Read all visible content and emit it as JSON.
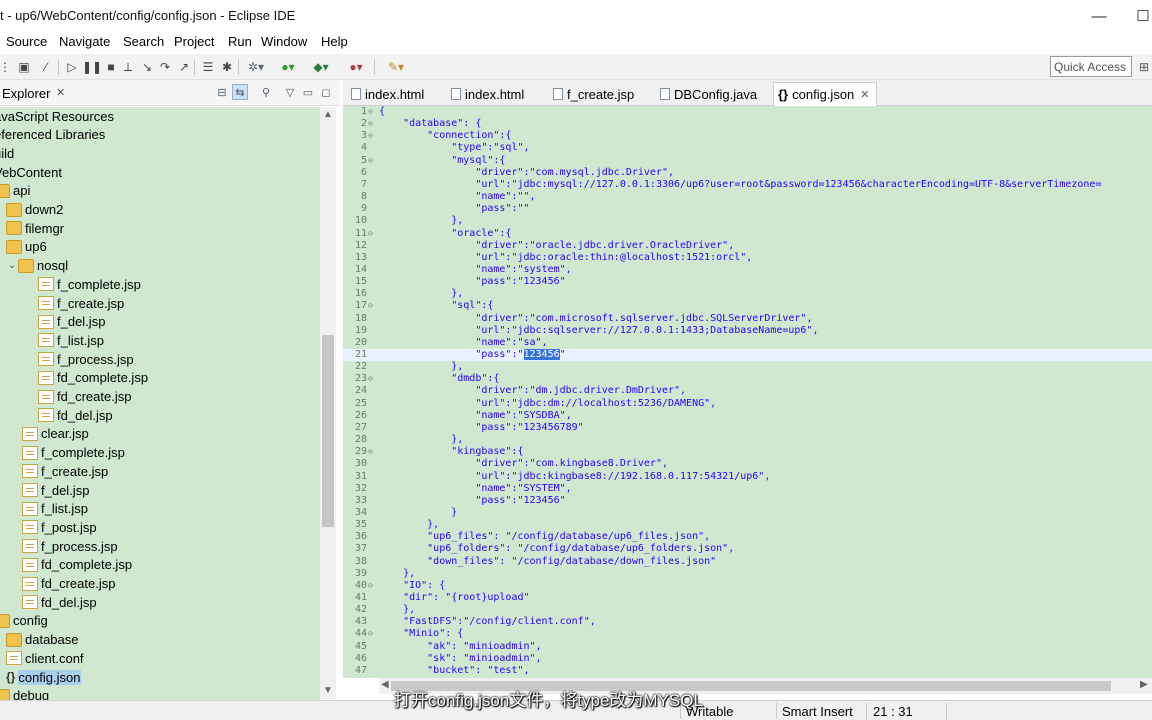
{
  "window": {
    "title": "t - up6/WebContent/config/config.json - Eclipse IDE",
    "minimize": "—",
    "maximize": "☐"
  },
  "menu": [
    "Source",
    "Navigate",
    "Search",
    "Project",
    "Run",
    "Window",
    "Help"
  ],
  "toolbar": {
    "quick_access": "Quick Access"
  },
  "explorer": {
    "title": "Explorer",
    "close": "✕",
    "tree": [
      {
        "label": "avaScript Resources",
        "kind": "plain",
        "indent": 0
      },
      {
        "label": "eferenced Libraries",
        "kind": "plain",
        "indent": 0
      },
      {
        "label": "uild",
        "kind": "plain",
        "indent": 0
      },
      {
        "label": "VebContent",
        "kind": "plain",
        "indent": 0
      },
      {
        "label": "api",
        "kind": "folder",
        "indent": 0
      },
      {
        "label": "down2",
        "kind": "folder",
        "indent": 1
      },
      {
        "label": "filemgr",
        "kind": "folder",
        "indent": 1
      },
      {
        "label": "up6",
        "kind": "folder",
        "indent": 1
      },
      {
        "label": "nosql",
        "kind": "folder-open",
        "indent": 1
      },
      {
        "label": "f_complete.jsp",
        "kind": "file",
        "indent": 3
      },
      {
        "label": "f_create.jsp",
        "kind": "file",
        "indent": 3
      },
      {
        "label": "f_del.jsp",
        "kind": "file",
        "indent": 3
      },
      {
        "label": "f_list.jsp",
        "kind": "file",
        "indent": 3
      },
      {
        "label": "f_process.jsp",
        "kind": "file",
        "indent": 3
      },
      {
        "label": "fd_complete.jsp",
        "kind": "file",
        "indent": 3
      },
      {
        "label": "fd_create.jsp",
        "kind": "file",
        "indent": 3
      },
      {
        "label": "fd_del.jsp",
        "kind": "file",
        "indent": 3
      },
      {
        "label": "clear.jsp",
        "kind": "file",
        "indent": 2
      },
      {
        "label": "f_complete.jsp",
        "kind": "file",
        "indent": 2
      },
      {
        "label": "f_create.jsp",
        "kind": "file",
        "indent": 2
      },
      {
        "label": "f_del.jsp",
        "kind": "file",
        "indent": 2
      },
      {
        "label": "f_list.jsp",
        "kind": "file",
        "indent": 2
      },
      {
        "label": "f_post.jsp",
        "kind": "file",
        "indent": 2
      },
      {
        "label": "f_process.jsp",
        "kind": "file",
        "indent": 2
      },
      {
        "label": "fd_complete.jsp",
        "kind": "file",
        "indent": 2
      },
      {
        "label": "fd_create.jsp",
        "kind": "file",
        "indent": 2
      },
      {
        "label": "fd_del.jsp",
        "kind": "file",
        "indent": 2
      },
      {
        "label": "config",
        "kind": "folder",
        "indent": 0
      },
      {
        "label": "database",
        "kind": "folder",
        "indent": 1
      },
      {
        "label": "client.conf",
        "kind": "file",
        "indent": 1
      },
      {
        "label": "config.json",
        "kind": "json",
        "indent": 1,
        "selected": true
      },
      {
        "label": "debug",
        "kind": "folder",
        "indent": 0
      }
    ]
  },
  "tabs": [
    {
      "label": "index.html",
      "icon": "html-file-icon"
    },
    {
      "label": "index.html",
      "icon": "html-file-icon"
    },
    {
      "label": "f_create.jsp",
      "icon": "jsp-file-icon"
    },
    {
      "label": "DBConfig.java",
      "icon": "java-file-icon"
    },
    {
      "label": "config.json",
      "icon": "json-file-icon",
      "active": true,
      "close": "✕"
    }
  ],
  "code": [
    {
      "n": "1",
      "f": "⊖",
      "t": "{"
    },
    {
      "n": "2",
      "f": "⊖",
      "t": "    \"database\": {"
    },
    {
      "n": "3",
      "f": "⊖",
      "t": "        \"connection\":{"
    },
    {
      "n": "4",
      "f": "",
      "t": "            \"type\":\"sql\","
    },
    {
      "n": "5",
      "f": "⊖",
      "t": "            \"mysql\":{"
    },
    {
      "n": "6",
      "f": "",
      "t": "                \"driver\":\"com.mysql.jdbc.Driver\","
    },
    {
      "n": "7",
      "f": "",
      "t": "                \"url\":\"jdbc:mysql://127.0.0.1:3306/up6?user=root&password=123456&characterEncoding=UTF-8&serverTimezone="
    },
    {
      "n": "8",
      "f": "",
      "t": "                \"name\":\"\","
    },
    {
      "n": "9",
      "f": "",
      "t": "                \"pass\":\"\""
    },
    {
      "n": "10",
      "f": "",
      "t": "            },"
    },
    {
      "n": "11",
      "f": "⊖",
      "t": "            \"oracle\":{"
    },
    {
      "n": "12",
      "f": "",
      "t": "                \"driver\":\"oracle.jdbc.driver.OracleDriver\","
    },
    {
      "n": "13",
      "f": "",
      "t": "                \"url\":\"jdbc:oracle:thin:@localhost:1521:orcl\","
    },
    {
      "n": "14",
      "f": "",
      "t": "                \"name\":\"system\","
    },
    {
      "n": "15",
      "f": "",
      "t": "                \"pass\":\"123456\""
    },
    {
      "n": "16",
      "f": "",
      "t": "            },"
    },
    {
      "n": "17",
      "f": "⊖",
      "t": "            \"sql\":{"
    },
    {
      "n": "18",
      "f": "",
      "t": "                \"driver\":\"com.microsoft.sqlserver.jdbc.SQLServerDriver\","
    },
    {
      "n": "19",
      "f": "",
      "t": "                \"url\":\"jdbc:sqlserver://127.0.0.1:1433;DatabaseName=up6\","
    },
    {
      "n": "20",
      "f": "",
      "t": "                \"name\":\"sa\","
    },
    {
      "n": "21",
      "f": "",
      "t": "                \"pass\":\"123456\"",
      "current": true,
      "hl": "123456"
    },
    {
      "n": "22",
      "f": "",
      "t": "            },"
    },
    {
      "n": "23",
      "f": "⊖",
      "t": "            \"dmdb\":{"
    },
    {
      "n": "24",
      "f": "",
      "t": "                \"driver\":\"dm.jdbc.driver.DmDriver\","
    },
    {
      "n": "25",
      "f": "",
      "t": "                \"url\":\"jdbc:dm://localhost:5236/DAMENG\","
    },
    {
      "n": "26",
      "f": "",
      "t": "                \"name\":\"SYSDBA\","
    },
    {
      "n": "27",
      "f": "",
      "t": "                \"pass\":\"123456789\""
    },
    {
      "n": "28",
      "f": "",
      "t": "            },"
    },
    {
      "n": "29",
      "f": "⊖",
      "t": "            \"kingbase\":{"
    },
    {
      "n": "30",
      "f": "",
      "t": "                \"driver\":\"com.kingbase8.Driver\","
    },
    {
      "n": "31",
      "f": "",
      "t": "                \"url\":\"jdbc:kingbase8://192.168.0.117:54321/up6\","
    },
    {
      "n": "32",
      "f": "",
      "t": "                \"name\":\"SYSTEM\","
    },
    {
      "n": "33",
      "f": "",
      "t": "                \"pass\":\"123456\""
    },
    {
      "n": "34",
      "f": "",
      "t": "            }"
    },
    {
      "n": "35",
      "f": "",
      "t": "        },"
    },
    {
      "n": "36",
      "f": "",
      "t": "        \"up6_files\": \"/config/database/up6_files.json\","
    },
    {
      "n": "37",
      "f": "",
      "t": "        \"up6_folders\": \"/config/database/up6_folders.json\","
    },
    {
      "n": "38",
      "f": "",
      "t": "        \"down_files\": \"/config/database/down_files.json\""
    },
    {
      "n": "39",
      "f": "",
      "t": "    },"
    },
    {
      "n": "40",
      "f": "⊖",
      "t": "    \"IO\": {"
    },
    {
      "n": "41",
      "f": "",
      "t": "    \"dir\": \"{root}upload\""
    },
    {
      "n": "42",
      "f": "",
      "t": "    },"
    },
    {
      "n": "43",
      "f": "",
      "t": "    \"FastDFS\":\"/config/client.conf\","
    },
    {
      "n": "44",
      "f": "⊖",
      "t": "    \"Minio\": {"
    },
    {
      "n": "45",
      "f": "",
      "t": "        \"ak\": \"minioadmin\","
    },
    {
      "n": "46",
      "f": "",
      "t": "        \"sk\": \"minioadmin\","
    },
    {
      "n": "47",
      "f": "",
      "t": "        \"bucket\": \"test\","
    }
  ],
  "status": {
    "writable": "Writable",
    "insert_mode": "Smart Insert",
    "position": "21 : 31"
  },
  "subtitle": "打开config.json文件，将type改为MYSQL"
}
